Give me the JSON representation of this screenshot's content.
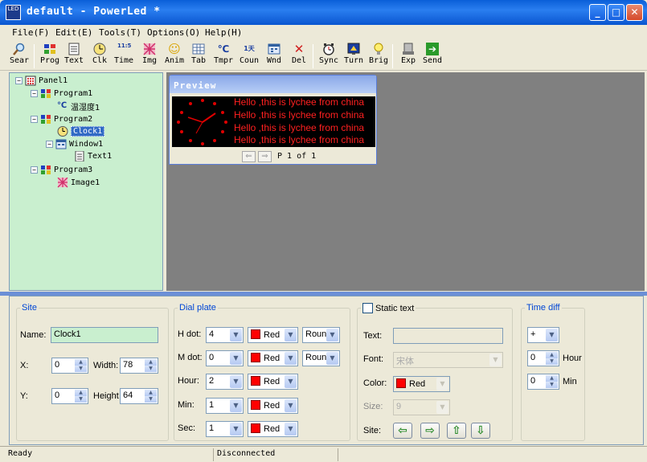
{
  "window": {
    "title": "default - PowerLed *",
    "app_icon_text": "LED",
    "minimize": "_",
    "maximize": "□",
    "close": "✕"
  },
  "menu": [
    "File(F)",
    "Edit(E)",
    "Tools(T)",
    "Options(O)",
    "Help(H)"
  ],
  "toolbar": [
    {
      "label": "Sear",
      "icon": "search-icon"
    },
    {
      "label": "Prog",
      "icon": "program-icon"
    },
    {
      "label": "Text",
      "icon": "text-icon"
    },
    {
      "label": "Clk",
      "icon": "clock-icon"
    },
    {
      "label": "Time",
      "icon": "time-icon",
      "glyph": "11:5"
    },
    {
      "label": "Img",
      "icon": "image-icon"
    },
    {
      "label": "Anim",
      "icon": "animation-icon",
      "glyph": "☺"
    },
    {
      "label": "Tab",
      "icon": "table-icon"
    },
    {
      "label": "Tmpr",
      "icon": "temperature-icon",
      "glyph": "℃"
    },
    {
      "label": "Coun",
      "icon": "counter-icon",
      "glyph": "1天"
    },
    {
      "label": "Wnd",
      "icon": "window-icon"
    },
    {
      "label": "Del",
      "icon": "delete-icon",
      "glyph": "✕"
    },
    {
      "label": "Sync",
      "icon": "sync-icon"
    },
    {
      "label": "Turn",
      "icon": "turn-icon"
    },
    {
      "label": "Brig",
      "icon": "brightness-icon"
    },
    {
      "label": "Exp",
      "icon": "export-icon"
    },
    {
      "label": "Send",
      "icon": "send-icon",
      "glyph": "➔"
    }
  ],
  "tree": {
    "panel": "Panel1",
    "program1": "Program1",
    "temp": "温湿度1",
    "temp_glyph": "℃",
    "program2": "Program2",
    "clock": "Clock1",
    "window": "Window1",
    "text": "Text1",
    "program3": "Program3",
    "image": "Image1",
    "minus": "−"
  },
  "preview": {
    "title": "Preview",
    "lines": [
      "Hello ,this is lychee from china",
      "Hello ,this is lychee from china",
      "Hello ,this is lychee from china",
      "Hello ,this is lychee from china"
    ],
    "prev": "⇐",
    "next": "⇒",
    "page": "P 1 of 1"
  },
  "site": {
    "legend": "Site",
    "name_label": "Name:",
    "name_value": "Clock1",
    "x_label": "X:",
    "x_value": "0",
    "width_label": "Width:",
    "width_value": "78",
    "y_label": "Y:",
    "y_value": "0",
    "height_label": "Height",
    "height_value": "64"
  },
  "dial": {
    "legend": "Dial plate",
    "rows": [
      {
        "label": "H dot:",
        "value": "4",
        "color": "Red",
        "shape": "Roun"
      },
      {
        "label": "M dot:",
        "value": "0",
        "color": "Red",
        "shape": "Roun"
      },
      {
        "label": "Hour:",
        "value": "2",
        "color": "Red"
      },
      {
        "label": "Min:",
        "value": "1",
        "color": "Red"
      },
      {
        "label": "Sec:",
        "value": "1",
        "color": "Red"
      }
    ]
  },
  "static_text": {
    "legend": "Static text",
    "text_label": "Text:",
    "text_value": "",
    "font_label": "Font:",
    "font_value": "宋体",
    "color_label": "Color:",
    "color_value": "Red",
    "size_label": "Size:",
    "size_value": "9",
    "site_label": "Site:",
    "site_buttons": [
      "⇦",
      "⇨",
      "⇧",
      "⇩"
    ]
  },
  "time_diff": {
    "legend": "Time diff",
    "sign": "+",
    "hour_value": "0",
    "hour_label": "Hour",
    "min_value": "0",
    "min_label": "Min"
  },
  "spin_glyphs": {
    "up": "▲",
    "down": "▼"
  },
  "combo_arrow": "▼",
  "status": {
    "ready": "Ready",
    "connection": "Disconnected"
  },
  "colors": {
    "accent": "#0a5fd8",
    "tree_bg": "#c9efcf",
    "led_red": "#ff2020",
    "selection": "#316ac5"
  }
}
